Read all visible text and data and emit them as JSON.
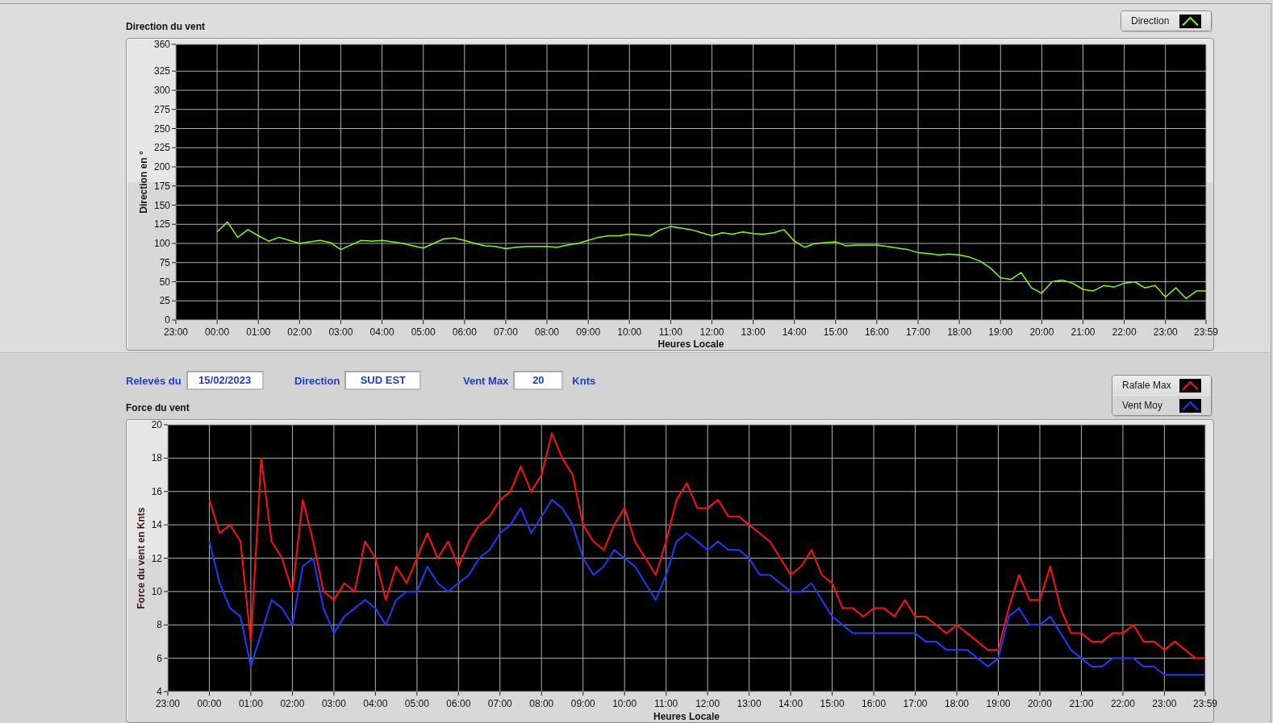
{
  "direction_chart": {
    "chart_data": {
      "type": "line",
      "title": "Direction du vent",
      "xlabel": "Heures Locale",
      "ylabel": "Direction en °",
      "grid": true,
      "x": [
        "2023-02-15T00:00",
        "2023-02-15T00:15",
        "2023-02-15T00:30",
        "2023-02-15T00:45",
        "2023-02-15T01:00",
        "2023-02-15T01:15",
        "2023-02-15T01:30",
        "2023-02-15T01:45",
        "2023-02-15T02:00",
        "2023-02-15T02:15",
        "2023-02-15T02:30",
        "2023-02-15T02:45",
        "2023-02-15T03:00",
        "2023-02-15T03:15",
        "2023-02-15T03:30",
        "2023-02-15T03:45",
        "2023-02-15T04:00",
        "2023-02-15T04:15",
        "2023-02-15T04:30",
        "2023-02-15T04:45",
        "2023-02-15T05:00",
        "2023-02-15T05:15",
        "2023-02-15T05:30",
        "2023-02-15T05:45",
        "2023-02-15T06:00",
        "2023-02-15T06:15",
        "2023-02-15T06:30",
        "2023-02-15T06:45",
        "2023-02-15T07:00",
        "2023-02-15T07:15",
        "2023-02-15T07:30",
        "2023-02-15T07:45",
        "2023-02-15T08:00",
        "2023-02-15T08:15",
        "2023-02-15T08:30",
        "2023-02-15T08:45",
        "2023-02-15T09:00",
        "2023-02-15T09:15",
        "2023-02-15T09:30",
        "2023-02-15T09:45",
        "2023-02-15T10:00",
        "2023-02-15T10:15",
        "2023-02-15T10:30",
        "2023-02-15T10:45",
        "2023-02-15T11:00",
        "2023-02-15T11:15",
        "2023-02-15T11:30",
        "2023-02-15T11:45",
        "2023-02-15T12:00",
        "2023-02-15T12:15",
        "2023-02-15T12:30",
        "2023-02-15T12:45",
        "2023-02-15T13:00",
        "2023-02-15T13:15",
        "2023-02-15T13:30",
        "2023-02-15T13:45",
        "2023-02-15T14:00",
        "2023-02-15T14:15",
        "2023-02-15T14:30",
        "2023-02-15T14:45",
        "2023-02-15T15:00",
        "2023-02-15T15:15",
        "2023-02-15T15:30",
        "2023-02-15T15:45",
        "2023-02-15T16:00",
        "2023-02-15T16:15",
        "2023-02-15T16:30",
        "2023-02-15T16:45",
        "2023-02-15T17:00",
        "2023-02-15T17:15",
        "2023-02-15T17:30",
        "2023-02-15T17:45",
        "2023-02-15T18:00",
        "2023-02-15T18:15",
        "2023-02-15T18:30",
        "2023-02-15T18:45",
        "2023-02-15T19:00",
        "2023-02-15T19:15",
        "2023-02-15T19:30",
        "2023-02-15T19:45",
        "2023-02-15T20:00",
        "2023-02-15T20:15",
        "2023-02-15T20:30",
        "2023-02-15T20:45",
        "2023-02-15T21:00",
        "2023-02-15T21:15",
        "2023-02-15T21:30",
        "2023-02-15T21:45",
        "2023-02-15T22:00",
        "2023-02-15T22:15",
        "2023-02-15T22:30",
        "2023-02-15T22:45",
        "2023-02-15T23:00",
        "2023-02-15T23:15",
        "2023-02-15T23:30",
        "2023-02-15T23:45",
        "2023-02-15T23:59"
      ],
      "series": [
        {
          "name": "Direction",
          "color": "#80ff00",
          "values": [
            115,
            128,
            108,
            118,
            110,
            103,
            108,
            104,
            100,
            102,
            104,
            101,
            92,
            98,
            104,
            103,
            104,
            102,
            100,
            97,
            94,
            100,
            106,
            107,
            104,
            100,
            97,
            96,
            93,
            95,
            96,
            96,
            96,
            95,
            98,
            100,
            104,
            108,
            110,
            110,
            112,
            111,
            110,
            118,
            122,
            120,
            118,
            114,
            110,
            114,
            112,
            115,
            113,
            112,
            114,
            118,
            103,
            95,
            100,
            101,
            102,
            97,
            98,
            98,
            98,
            96,
            94,
            92,
            88,
            87,
            85,
            86,
            85,
            82,
            77,
            68,
            55,
            53,
            62,
            42,
            35,
            50,
            52,
            48,
            40,
            38,
            45,
            43,
            48,
            50,
            42,
            45,
            30,
            42,
            28,
            38,
            38
          ]
        }
      ],
      "xlim": [
        "2023-02-14T23:00",
        "2023-02-15T23:59"
      ],
      "ylim": [
        0,
        360
      ],
      "xticks": [
        {
          "value": "2023-02-14T23:00",
          "label": "23:00"
        },
        {
          "value": "2023-02-15T00:00",
          "label": "00:00"
        },
        {
          "value": "2023-02-15T01:00",
          "label": "01:00"
        },
        {
          "value": "2023-02-15T02:00",
          "label": "02:00"
        },
        {
          "value": "2023-02-15T03:00",
          "label": "03:00"
        },
        {
          "value": "2023-02-15T04:00",
          "label": "04:00"
        },
        {
          "value": "2023-02-15T05:00",
          "label": "05:00"
        },
        {
          "value": "2023-02-15T06:00",
          "label": "06:00"
        },
        {
          "value": "2023-02-15T07:00",
          "label": "07:00"
        },
        {
          "value": "2023-02-15T08:00",
          "label": "08:00"
        },
        {
          "value": "2023-02-15T09:00",
          "label": "09:00"
        },
        {
          "value": "2023-02-15T10:00",
          "label": "10:00"
        },
        {
          "value": "2023-02-15T11:00",
          "label": "11:00"
        },
        {
          "value": "2023-02-15T12:00",
          "label": "12:00"
        },
        {
          "value": "2023-02-15T13:00",
          "label": "13:00"
        },
        {
          "value": "2023-02-15T14:00",
          "label": "14:00"
        },
        {
          "value": "2023-02-15T15:00",
          "label": "15:00"
        },
        {
          "value": "2023-02-15T16:00",
          "label": "16:00"
        },
        {
          "value": "2023-02-15T17:00",
          "label": "17:00"
        },
        {
          "value": "2023-02-15T18:00",
          "label": "18:00"
        },
        {
          "value": "2023-02-15T19:00",
          "label": "19:00"
        },
        {
          "value": "2023-02-15T20:00",
          "label": "20:00"
        },
        {
          "value": "2023-02-15T21:00",
          "label": "21:00"
        },
        {
          "value": "2023-02-15T22:00",
          "label": "22:00"
        },
        {
          "value": "2023-02-15T23:00",
          "label": "23:00"
        },
        {
          "value": "2023-02-15T23:59",
          "label": "23:59"
        }
      ],
      "yticks": [
        0,
        25,
        50,
        75,
        100,
        125,
        150,
        175,
        200,
        225,
        250,
        275,
        300,
        325,
        360
      ]
    }
  },
  "fields": [
    {
      "label": "Relevés du",
      "value": "15/02/2023"
    },
    {
      "label": "Direction",
      "value": "SUD EST"
    },
    {
      "label": "Vent Max",
      "value": "20",
      "unit": "Knts"
    }
  ],
  "force_chart": {
    "chart_data": {
      "type": "line",
      "title": "Force du vent",
      "xlabel": "Heures Locale",
      "ylabel": "Force du vent en Knts",
      "grid": true,
      "x": [
        "2023-02-15T00:00",
        "2023-02-15T00:15",
        "2023-02-15T00:30",
        "2023-02-15T00:45",
        "2023-02-15T01:00",
        "2023-02-15T01:15",
        "2023-02-15T01:30",
        "2023-02-15T01:45",
        "2023-02-15T02:00",
        "2023-02-15T02:15",
        "2023-02-15T02:30",
        "2023-02-15T02:45",
        "2023-02-15T03:00",
        "2023-02-15T03:15",
        "2023-02-15T03:30",
        "2023-02-15T03:45",
        "2023-02-15T04:00",
        "2023-02-15T04:15",
        "2023-02-15T04:30",
        "2023-02-15T04:45",
        "2023-02-15T05:00",
        "2023-02-15T05:15",
        "2023-02-15T05:30",
        "2023-02-15T05:45",
        "2023-02-15T06:00",
        "2023-02-15T06:15",
        "2023-02-15T06:30",
        "2023-02-15T06:45",
        "2023-02-15T07:00",
        "2023-02-15T07:15",
        "2023-02-15T07:30",
        "2023-02-15T07:45",
        "2023-02-15T08:00",
        "2023-02-15T08:15",
        "2023-02-15T08:30",
        "2023-02-15T08:45",
        "2023-02-15T09:00",
        "2023-02-15T09:15",
        "2023-02-15T09:30",
        "2023-02-15T09:45",
        "2023-02-15T10:00",
        "2023-02-15T10:15",
        "2023-02-15T10:30",
        "2023-02-15T10:45",
        "2023-02-15T11:00",
        "2023-02-15T11:15",
        "2023-02-15T11:30",
        "2023-02-15T11:45",
        "2023-02-15T12:00",
        "2023-02-15T12:15",
        "2023-02-15T12:30",
        "2023-02-15T12:45",
        "2023-02-15T13:00",
        "2023-02-15T13:15",
        "2023-02-15T13:30",
        "2023-02-15T13:45",
        "2023-02-15T14:00",
        "2023-02-15T14:15",
        "2023-02-15T14:30",
        "2023-02-15T14:45",
        "2023-02-15T15:00",
        "2023-02-15T15:15",
        "2023-02-15T15:30",
        "2023-02-15T15:45",
        "2023-02-15T16:00",
        "2023-02-15T16:15",
        "2023-02-15T16:30",
        "2023-02-15T16:45",
        "2023-02-15T17:00",
        "2023-02-15T17:15",
        "2023-02-15T17:30",
        "2023-02-15T17:45",
        "2023-02-15T18:00",
        "2023-02-15T18:15",
        "2023-02-15T18:30",
        "2023-02-15T18:45",
        "2023-02-15T19:00",
        "2023-02-15T19:15",
        "2023-02-15T19:30",
        "2023-02-15T19:45",
        "2023-02-15T20:00",
        "2023-02-15T20:15",
        "2023-02-15T20:30",
        "2023-02-15T20:45",
        "2023-02-15T21:00",
        "2023-02-15T21:15",
        "2023-02-15T21:30",
        "2023-02-15T21:45",
        "2023-02-15T22:00",
        "2023-02-15T22:15",
        "2023-02-15T22:30",
        "2023-02-15T22:45",
        "2023-02-15T23:00",
        "2023-02-15T23:15",
        "2023-02-15T23:30",
        "2023-02-15T23:45",
        "2023-02-15T23:59"
      ],
      "series": [
        {
          "name": "Rafale Max",
          "color": "#ff1010",
          "values": [
            15.5,
            13.5,
            14,
            13,
            7,
            18,
            13,
            12,
            10,
            15.5,
            13,
            10,
            9.5,
            10.5,
            10,
            13,
            12,
            9.5,
            11.5,
            10.5,
            12,
            13.5,
            12,
            13,
            11.5,
            13,
            14,
            14.5,
            15.5,
            16,
            17.5,
            16,
            17,
            19.5,
            18,
            17,
            14,
            13,
            12.5,
            14,
            15,
            13,
            12,
            11,
            13,
            15.5,
            16.5,
            15,
            15,
            15.5,
            14.5,
            14.5,
            14,
            13.5,
            13,
            12,
            11,
            11.5,
            12.5,
            11,
            10.5,
            9,
            9,
            8.5,
            9,
            9,
            8.5,
            9.5,
            8.5,
            8.5,
            8,
            7.5,
            8,
            7.5,
            7,
            6.5,
            6.5,
            9,
            11,
            9.5,
            9.5,
            11.5,
            9,
            7.5,
            7.5,
            7,
            7,
            7.5,
            7.5,
            8,
            7,
            7,
            6.5,
            7,
            6.5,
            6,
            6
          ]
        },
        {
          "name": "Vent Moy",
          "color": "#1a3cff",
          "values": [
            13,
            10.5,
            9,
            8.5,
            5.5,
            7.5,
            9.5,
            9,
            8,
            11.5,
            12,
            9,
            7.5,
            8.5,
            9,
            9.5,
            9,
            8,
            9.5,
            10,
            10,
            11.5,
            10.5,
            10,
            10.5,
            11,
            12,
            12.5,
            13.5,
            14,
            15,
            13.5,
            14.5,
            15.5,
            15,
            14,
            12,
            11,
            11.5,
            12.5,
            12,
            11.5,
            10.5,
            9.5,
            11,
            13,
            13.5,
            13,
            12.5,
            13,
            12.5,
            12.5,
            12,
            11,
            11,
            10.5,
            10,
            10,
            10.5,
            9.5,
            8.5,
            8,
            7.5,
            7.5,
            7.5,
            7.5,
            7.5,
            7.5,
            7.5,
            7,
            7,
            6.5,
            6.5,
            6.5,
            6,
            5.5,
            6,
            8.5,
            9,
            8,
            8,
            8.5,
            7.5,
            6.5,
            6,
            5.5,
            5.5,
            6,
            6,
            6,
            5.5,
            5.5,
            5,
            5,
            5,
            5,
            5
          ]
        }
      ],
      "xlim": [
        "2023-02-14T23:00",
        "2023-02-15T23:59"
      ],
      "ylim": [
        4,
        20
      ],
      "xticks": [
        {
          "value": "2023-02-14T23:00",
          "label": "23:00"
        },
        {
          "value": "2023-02-15T00:00",
          "label": "00:00"
        },
        {
          "value": "2023-02-15T01:00",
          "label": "01:00"
        },
        {
          "value": "2023-02-15T02:00",
          "label": "02:00"
        },
        {
          "value": "2023-02-15T03:00",
          "label": "03:00"
        },
        {
          "value": "2023-02-15T04:00",
          "label": "04:00"
        },
        {
          "value": "2023-02-15T05:00",
          "label": "05:00"
        },
        {
          "value": "2023-02-15T06:00",
          "label": "06:00"
        },
        {
          "value": "2023-02-15T07:00",
          "label": "07:00"
        },
        {
          "value": "2023-02-15T08:00",
          "label": "08:00"
        },
        {
          "value": "2023-02-15T09:00",
          "label": "09:00"
        },
        {
          "value": "2023-02-15T10:00",
          "label": "10:00"
        },
        {
          "value": "2023-02-15T11:00",
          "label": "11:00"
        },
        {
          "value": "2023-02-15T12:00",
          "label": "12:00"
        },
        {
          "value": "2023-02-15T13:00",
          "label": "13:00"
        },
        {
          "value": "2023-02-15T14:00",
          "label": "14:00"
        },
        {
          "value": "2023-02-15T15:00",
          "label": "15:00"
        },
        {
          "value": "2023-02-15T16:00",
          "label": "16:00"
        },
        {
          "value": "2023-02-15T17:00",
          "label": "17:00"
        },
        {
          "value": "2023-02-15T18:00",
          "label": "18:00"
        },
        {
          "value": "2023-02-15T19:00",
          "label": "19:00"
        },
        {
          "value": "2023-02-15T20:00",
          "label": "20:00"
        },
        {
          "value": "2023-02-15T21:00",
          "label": "21:00"
        },
        {
          "value": "2023-02-15T22:00",
          "label": "22:00"
        },
        {
          "value": "2023-02-15T23:00",
          "label": "23:00"
        },
        {
          "value": "2023-02-15T23:59",
          "label": "23:59"
        }
      ],
      "yticks": [
        4,
        6,
        8,
        10,
        12,
        14,
        16,
        18,
        20
      ]
    }
  }
}
